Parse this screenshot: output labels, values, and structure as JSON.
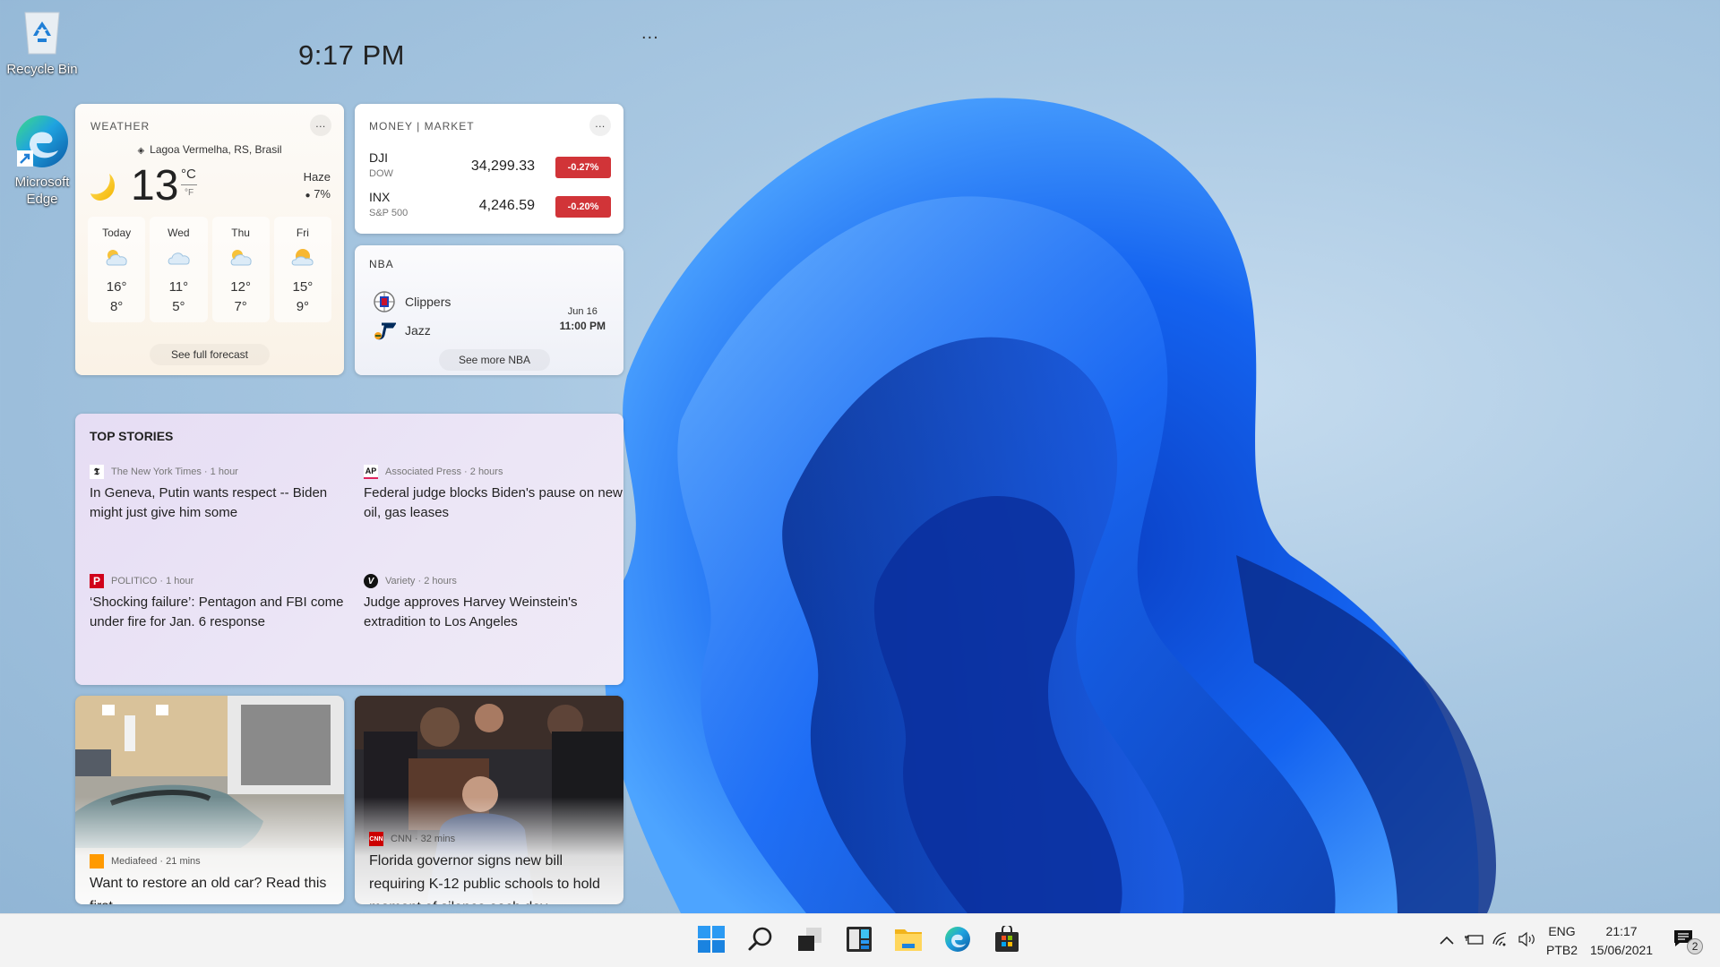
{
  "desktop": {
    "icons": [
      {
        "label": "Recycle Bin",
        "icon": "recycle-bin-icon"
      },
      {
        "label": "Microsoft Edge",
        "icon": "edge-icon"
      }
    ]
  },
  "widgets": {
    "time": "9:17 PM",
    "more_label": "...",
    "weather": {
      "title": "WEATHER",
      "more_label": "...",
      "location": "Lagoa Vermelha, RS, Brasil",
      "temperature": "13",
      "unit_active": "°C",
      "unit_alt": "°F",
      "condition": "Haze",
      "precipitation": "7%",
      "current_icon": "moon-icon",
      "forecast": [
        {
          "day": "Today",
          "icon": "partly-cloudy-icon",
          "high": "16°",
          "low": "8°"
        },
        {
          "day": "Wed",
          "icon": "cloudy-icon",
          "high": "11°",
          "low": "5°"
        },
        {
          "day": "Thu",
          "icon": "partly-cloudy-icon",
          "high": "12°",
          "low": "7°"
        },
        {
          "day": "Fri",
          "icon": "partly-cloudy-icon",
          "high": "15°",
          "low": "9°"
        }
      ],
      "see_full_forecast": "See full forecast"
    },
    "money": {
      "title": "MONEY | MARKET",
      "more_label": "...",
      "stocks": [
        {
          "symbol": "DJI",
          "name": "DOW",
          "price": "34,299.33",
          "change": "-0.27%"
        },
        {
          "symbol": "INX",
          "name": "S&P 500",
          "price": "4,246.59",
          "change": "-0.20%"
        }
      ],
      "negative_color": "#d13438"
    },
    "nba": {
      "title": "NBA",
      "home_team": "Clippers",
      "away_team": "Jazz",
      "date": "Jun 16",
      "time": "11:00 PM",
      "see_more": "See more NBA"
    },
    "top_stories": {
      "title": "TOP STORIES",
      "stories": [
        {
          "source": "The New York Times",
          "age": "1 hour",
          "logo": "T",
          "headline": "In Geneva, Putin wants respect -- Biden might just give him some"
        },
        {
          "source": "Associated Press",
          "age": "2 hours",
          "logo": "AP",
          "headline": "Federal judge blocks Biden's pause on new oil, gas leases"
        },
        {
          "source": "POLITICO",
          "age": "1 hour",
          "logo": "P",
          "headline": "‘Shocking failure’: Pentagon and FBI come under fire for Jan. 6 response"
        },
        {
          "source": "Variety",
          "age": "2 hours",
          "logo": "V",
          "headline": "Judge approves Harvey Weinstein's extradition to Los Angeles"
        }
      ]
    },
    "image_stories": [
      {
        "source": "Mediafeed",
        "age": "21 mins",
        "headline": "Want to restore an old car? Read this first"
      },
      {
        "source": "CNN",
        "age": "32 mins",
        "logo": "CNN",
        "headline": "Florida governor signs new bill requiring K-12 public schools to hold moment of silence each day"
      }
    ]
  },
  "taskbar": {
    "apps": [
      {
        "name": "Start",
        "icon": "windows-start-icon"
      },
      {
        "name": "Search",
        "icon": "search-icon"
      },
      {
        "name": "Task View",
        "icon": "task-view-icon"
      },
      {
        "name": "Widgets",
        "icon": "widgets-icon"
      },
      {
        "name": "File Explorer",
        "icon": "folder-icon"
      },
      {
        "name": "Microsoft Edge",
        "icon": "edge-icon"
      },
      {
        "name": "Microsoft Store",
        "icon": "store-icon"
      }
    ],
    "tray": {
      "language_top": "ENG",
      "language_bottom": "PTB2",
      "time": "21:17",
      "date": "15/06/2021",
      "notification_count": "2"
    }
  }
}
